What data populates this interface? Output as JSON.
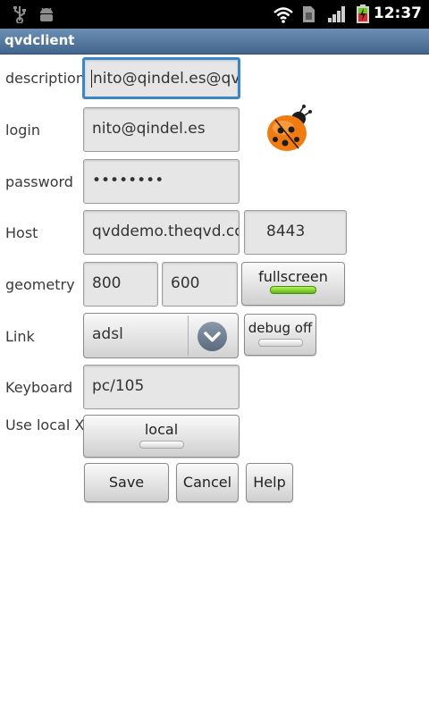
{
  "status_bar": {
    "time": "12:37",
    "icons": [
      "usb-icon",
      "android-debug-icon",
      "wifi-icon",
      "sim-card-icon",
      "signal-icon",
      "battery-charging-icon"
    ]
  },
  "app": {
    "title": "qvdclient"
  },
  "form": {
    "description": {
      "label": "description",
      "value": "nito@qindel.es@qv"
    },
    "login": {
      "label": "login",
      "value": "nito@qindel.es"
    },
    "password": {
      "label": "password",
      "value": "••••••••"
    },
    "host": {
      "label": "Host",
      "value": "qvddemo.theqvd.cc",
      "port": "8443"
    },
    "geometry": {
      "label": "geometry",
      "width": "800",
      "height": "600",
      "fullscreen": {
        "label": "fullscreen",
        "on": true
      }
    },
    "link": {
      "label": "Link",
      "selected": "adsl",
      "debug": {
        "label": "debug off",
        "on": false
      }
    },
    "keyboard": {
      "label": "Keyboard",
      "value": "pc/105"
    },
    "local_x": {
      "label": "Use local X",
      "toggle_label": "local",
      "on": false
    }
  },
  "buttons": {
    "save": "Save",
    "cancel": "Cancel",
    "help": "Help"
  },
  "colors": {
    "title_bar": "#41658c",
    "focus": "#3a87c8",
    "toggle_on": "#7fd02c"
  }
}
